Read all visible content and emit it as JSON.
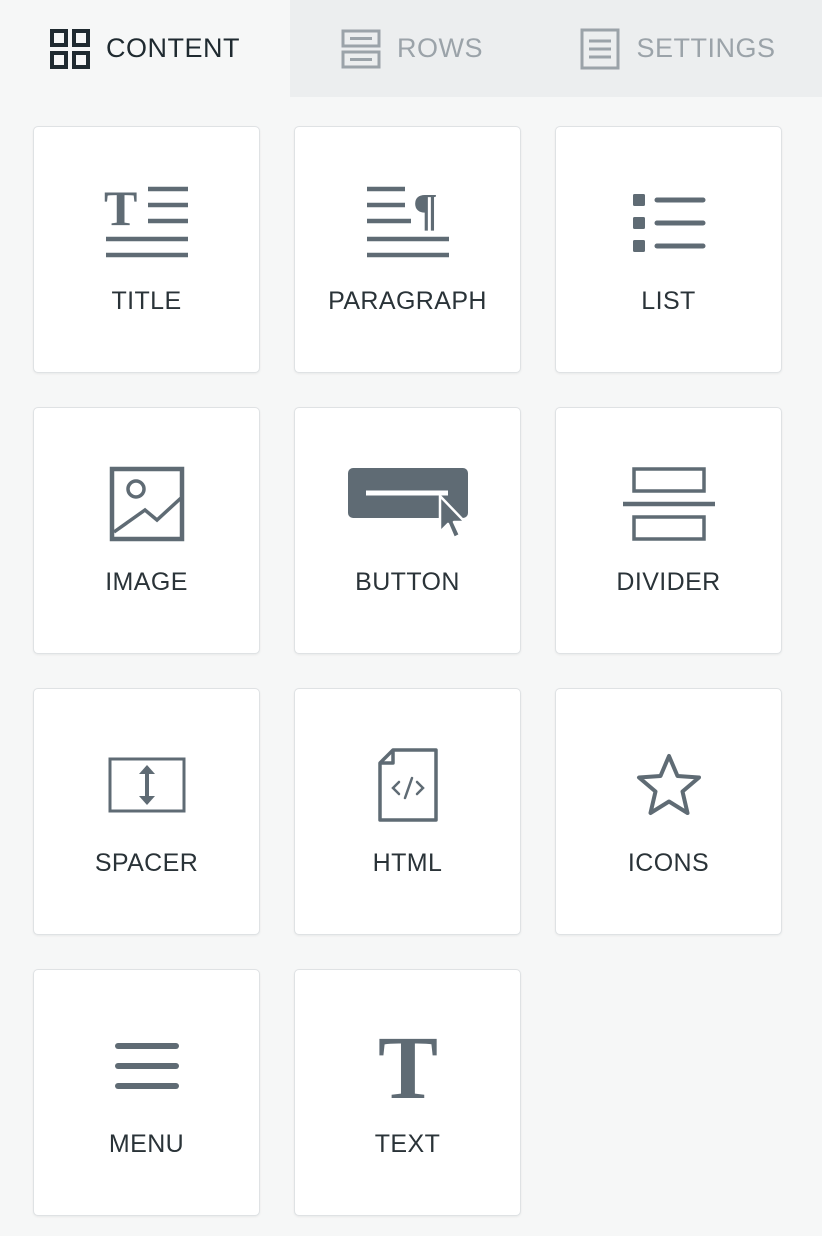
{
  "tabs": [
    {
      "label": "CONTENT",
      "icon": "grid-icon",
      "active": true
    },
    {
      "label": "ROWS",
      "icon": "rows-icon",
      "active": false
    },
    {
      "label": "SETTINGS",
      "icon": "settings-icon",
      "active": false
    }
  ],
  "tiles": [
    {
      "label": "TITLE",
      "icon": "title-icon"
    },
    {
      "label": "PARAGRAPH",
      "icon": "paragraph-icon"
    },
    {
      "label": "LIST",
      "icon": "list-icon"
    },
    {
      "label": "IMAGE",
      "icon": "image-icon"
    },
    {
      "label": "BUTTON",
      "icon": "button-icon"
    },
    {
      "label": "DIVIDER",
      "icon": "divider-icon"
    },
    {
      "label": "SPACER",
      "icon": "spacer-icon"
    },
    {
      "label": "HTML",
      "icon": "html-icon"
    },
    {
      "label": "ICONS",
      "icon": "star-icon"
    },
    {
      "label": "MENU",
      "icon": "menu-icon"
    },
    {
      "label": "TEXT",
      "icon": "text-icon"
    }
  ],
  "colors": {
    "icon": "#5f6b74",
    "tab_active_text": "#1f2a30",
    "tab_inactive_text": "#9ba3a9",
    "tab_bar_bg": "#eceeef",
    "panel_bg": "#f6f7f7",
    "tile_border": "#dfe2e4"
  }
}
